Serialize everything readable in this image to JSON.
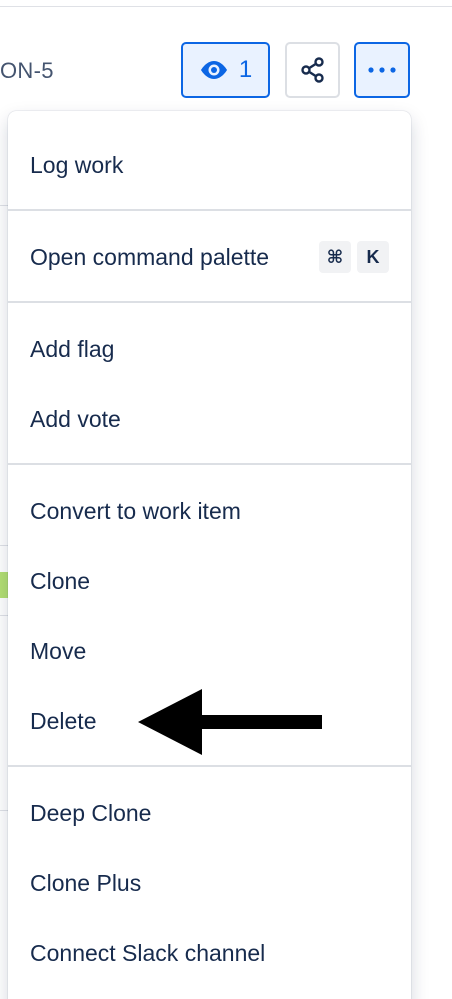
{
  "header": {
    "issue_key_fragment": "ON-5",
    "watchers_count": "1",
    "icons": {
      "watch": "eye-icon",
      "share": "share-icon",
      "more": "more-horizontal-icon"
    },
    "accent_color": "#0c66e4"
  },
  "menu": {
    "groups": [
      {
        "items": [
          "Log work"
        ]
      },
      {
        "items": [
          "Open command palette"
        ],
        "shortcut": [
          "⌘",
          "K"
        ]
      },
      {
        "items": [
          "Add flag",
          "Add vote"
        ]
      },
      {
        "items": [
          "Convert to work item",
          "Clone",
          "Move",
          "Delete"
        ]
      },
      {
        "items": [
          "Deep Clone",
          "Clone Plus",
          "Connect Slack channel"
        ]
      }
    ]
  },
  "annotation": {
    "type": "arrow",
    "points_to": "Delete",
    "color": "#000000"
  }
}
